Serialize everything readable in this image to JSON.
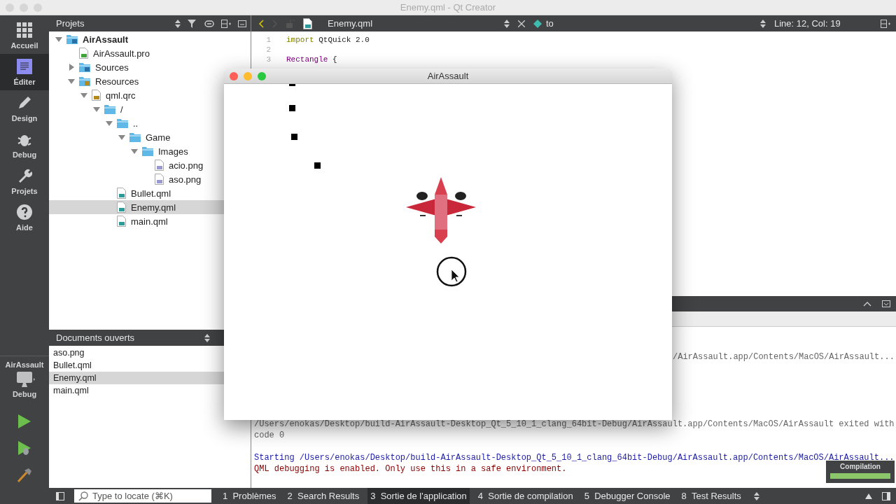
{
  "window": {
    "title": "Enemy.qml - Qt Creator"
  },
  "modes": [
    {
      "label": "Accueil",
      "kind": "grid",
      "selected": false
    },
    {
      "label": "Éditer",
      "kind": "edit",
      "selected": true
    },
    {
      "label": "Design",
      "kind": "pencil",
      "selected": false
    },
    {
      "label": "Debug",
      "kind": "bug",
      "selected": false
    },
    {
      "label": "Projets",
      "kind": "wrench",
      "selected": false
    },
    {
      "label": "Aide",
      "kind": "help",
      "selected": false
    }
  ],
  "kit": {
    "project": "AirAssault",
    "build": "Debug"
  },
  "projects_panel": {
    "title": "Projets",
    "tree": [
      {
        "label": "AirAssault",
        "kind": "project",
        "expanded": true,
        "selected": false,
        "children": [
          {
            "label": "AirAssault.pro",
            "kind": "pro",
            "selected": false
          },
          {
            "label": "Sources",
            "kind": "sources",
            "expanded": false,
            "selected": false
          },
          {
            "label": "Resources",
            "kind": "resources",
            "expanded": true,
            "selected": false,
            "children": [
              {
                "label": "qml.qrc",
                "kind": "qrc",
                "expanded": true,
                "selected": false,
                "children": [
                  {
                    "label": "/",
                    "kind": "folder",
                    "expanded": true,
                    "selected": false,
                    "children": [
                      {
                        "label": "..",
                        "kind": "folder",
                        "expanded": true,
                        "selected": false,
                        "children": [
                          {
                            "label": "Game",
                            "kind": "folder",
                            "expanded": true,
                            "selected": false,
                            "children": [
                              {
                                "label": "Images",
                                "kind": "folder",
                                "expanded": true,
                                "selected": false,
                                "children": [
                                  {
                                    "label": "acio.png",
                                    "kind": "png",
                                    "selected": false
                                  },
                                  {
                                    "label": "aso.png",
                                    "kind": "png",
                                    "selected": false
                                  }
                                ]
                              }
                            ]
                          }
                        ]
                      },
                      {
                        "label": "Bullet.qml",
                        "kind": "qml",
                        "selected": false
                      },
                      {
                        "label": "Enemy.qml",
                        "kind": "qml",
                        "selected": true
                      },
                      {
                        "label": "main.qml",
                        "kind": "qml",
                        "selected": false
                      }
                    ]
                  }
                ]
              }
            ]
          }
        ]
      }
    ]
  },
  "open_documents": {
    "title": "Documents ouverts",
    "items": [
      {
        "label": "aso.png",
        "selected": false
      },
      {
        "label": "Bullet.qml",
        "selected": false
      },
      {
        "label": "Enemy.qml",
        "selected": true
      },
      {
        "label": "main.qml",
        "selected": false
      }
    ]
  },
  "editor": {
    "file": "Enemy.qml",
    "symbol": "to",
    "position": "Line: 12, Col: 19",
    "lines": [
      {
        "number": "1",
        "code": [
          {
            "text": "import",
            "kind": "keyword"
          },
          {
            "text": " QtQuick 2.0",
            "kind": "plain"
          }
        ]
      },
      {
        "number": "2"
      },
      {
        "number": "3",
        "code": [
          {
            "text": "Rectangle",
            "kind": "type"
          },
          {
            "text": " {",
            "kind": "plain"
          }
        ]
      }
    ]
  },
  "output": {
    "lines": [
      {
        "text": "/AirAssault.app/Contents/MacOS/AirAssault...",
        "kind": "info"
      },
      {
        "text": "/Users/enokas/Desktop/build-AirAssault-Desktop_Qt_5_10_1_clang_64bit-Debug/AirAssault.app/Contents/MacOS/AirAssault exited with",
        "kind": "info"
      },
      {
        "text": "code 0",
        "kind": "info"
      },
      {
        "text": "Starting /Users/enokas/Desktop/build-AirAssault-Desktop_Qt_5_10_1_clang_64bit-Debug/AirAssault.app/Contents/MacOS/AirAssault...",
        "kind": "start"
      },
      {
        "text": "QML debugging is enabled. Only use this in a safe environment.",
        "kind": "debug"
      }
    ]
  },
  "compilation": {
    "label": "Compilation",
    "level": 1
  },
  "status_bar": {
    "locator_placeholder": "Type to locate (⌘K)",
    "tabs": [
      {
        "number": "1",
        "label": "Problèmes",
        "selected": false
      },
      {
        "number": "2",
        "label": "Search Results",
        "selected": false
      },
      {
        "number": "3",
        "label": "Sortie de l'application",
        "selected": true
      },
      {
        "number": "4",
        "label": "Sortie de compilation",
        "selected": false
      },
      {
        "number": "5",
        "label": "Debugger Console",
        "selected": false
      },
      {
        "number": "8",
        "label": "Test Results",
        "selected": false
      }
    ]
  },
  "app_window": {
    "title": "AirAssault"
  }
}
